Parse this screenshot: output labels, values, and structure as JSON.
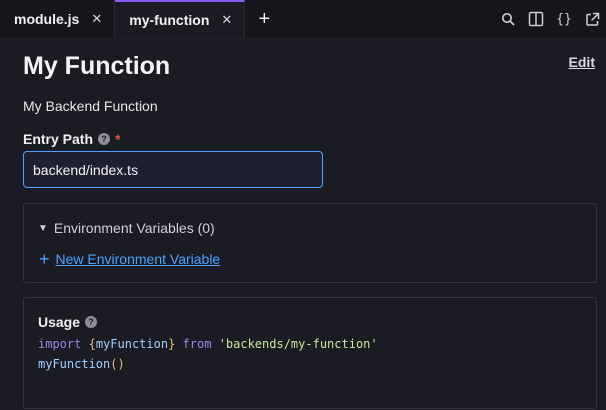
{
  "tabs": [
    {
      "label": "module.js",
      "active": false
    },
    {
      "label": "my-function",
      "active": true
    }
  ],
  "tab_add_icon": "plus-icon",
  "toolbar_icons": [
    "search-icon",
    "split-view-icon",
    "code-braces-icon",
    "open-external-icon"
  ],
  "page": {
    "title": "My Function",
    "edit_label": "Edit",
    "description": "My Backend Function"
  },
  "entry_path": {
    "label": "Entry Path",
    "required_marker": "*",
    "value": "backend/index.ts"
  },
  "env": {
    "header": "Environment Variables (0)",
    "add_label": "New Environment Variable"
  },
  "usage": {
    "label": "Usage",
    "code": {
      "kw_import": "import",
      "brace_open": "{",
      "identifier": "myFunction",
      "brace_close": "}",
      "kw_from": "from",
      "module": "'backends/my-function'",
      "call_name": "myFunction",
      "call_parens": "()"
    }
  },
  "colors": {
    "accent": "#8b5cf6",
    "link": "#4aa3ff",
    "required": "#e25555"
  }
}
